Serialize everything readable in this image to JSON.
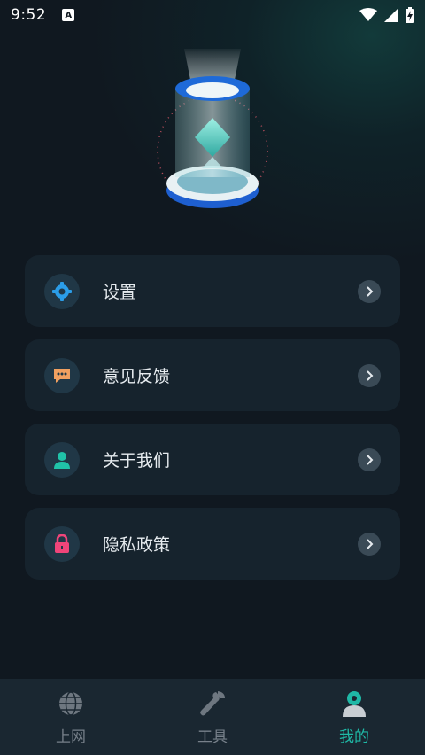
{
  "status_bar": {
    "time": "9:52",
    "notification_icon": "A"
  },
  "menu": {
    "items": [
      {
        "label": "设置",
        "icon": "gear-icon",
        "color": "#2b9de8"
      },
      {
        "label": "意见反馈",
        "icon": "message-icon",
        "color": "#f0a060"
      },
      {
        "label": "关于我们",
        "icon": "person-icon",
        "color": "#20c2a8"
      },
      {
        "label": "隐私政策",
        "icon": "lock-icon",
        "color": "#f0457a"
      }
    ]
  },
  "tabbar": {
    "tabs": [
      {
        "label": "上网",
        "icon": "globe-icon",
        "active": false
      },
      {
        "label": "工具",
        "icon": "wrench-icon",
        "active": false
      },
      {
        "label": "我的",
        "icon": "profile-icon",
        "active": true
      }
    ]
  },
  "colors": {
    "accent": "#1fb8a6",
    "card": "#16232d",
    "background": "#101820"
  }
}
